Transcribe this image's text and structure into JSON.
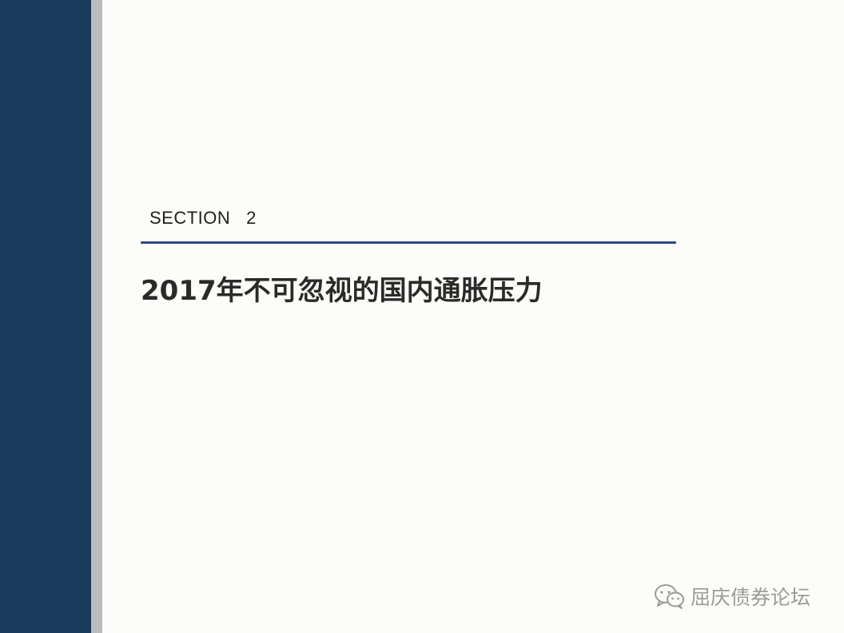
{
  "slide": {
    "section_label": "SECTION   2",
    "title": "2017年不可忽视的国内通胀压力",
    "watermark": {
      "icon": "wechat-icon",
      "text": "屈庆债券论坛"
    }
  },
  "colors": {
    "side_band": "#1c3a5e",
    "side_stripe": "#bcbcbc",
    "divider": "#2b4c7e",
    "background": "#fcfdfb"
  }
}
